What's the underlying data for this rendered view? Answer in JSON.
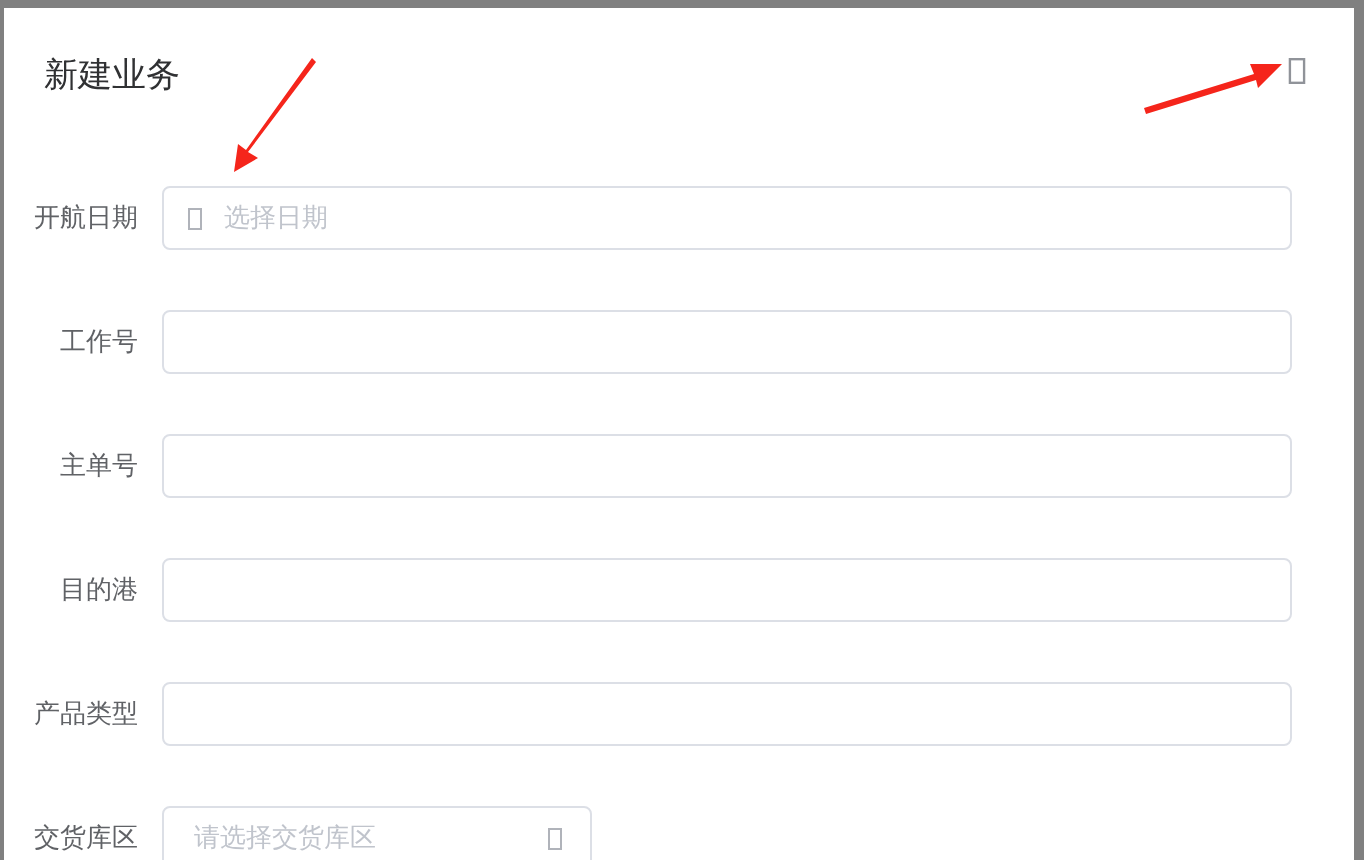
{
  "dialog": {
    "title": "新建业务"
  },
  "fields": [
    {
      "label": "开航日期",
      "kind": "date",
      "placeholder": "选择日期"
    },
    {
      "label": "工作号",
      "kind": "text"
    },
    {
      "label": "主单号",
      "kind": "text"
    },
    {
      "label": "目的港",
      "kind": "text"
    },
    {
      "label": "产品类型",
      "kind": "text"
    },
    {
      "label": "交货库区",
      "kind": "select",
      "placeholder": "请选择交货库区"
    }
  ]
}
